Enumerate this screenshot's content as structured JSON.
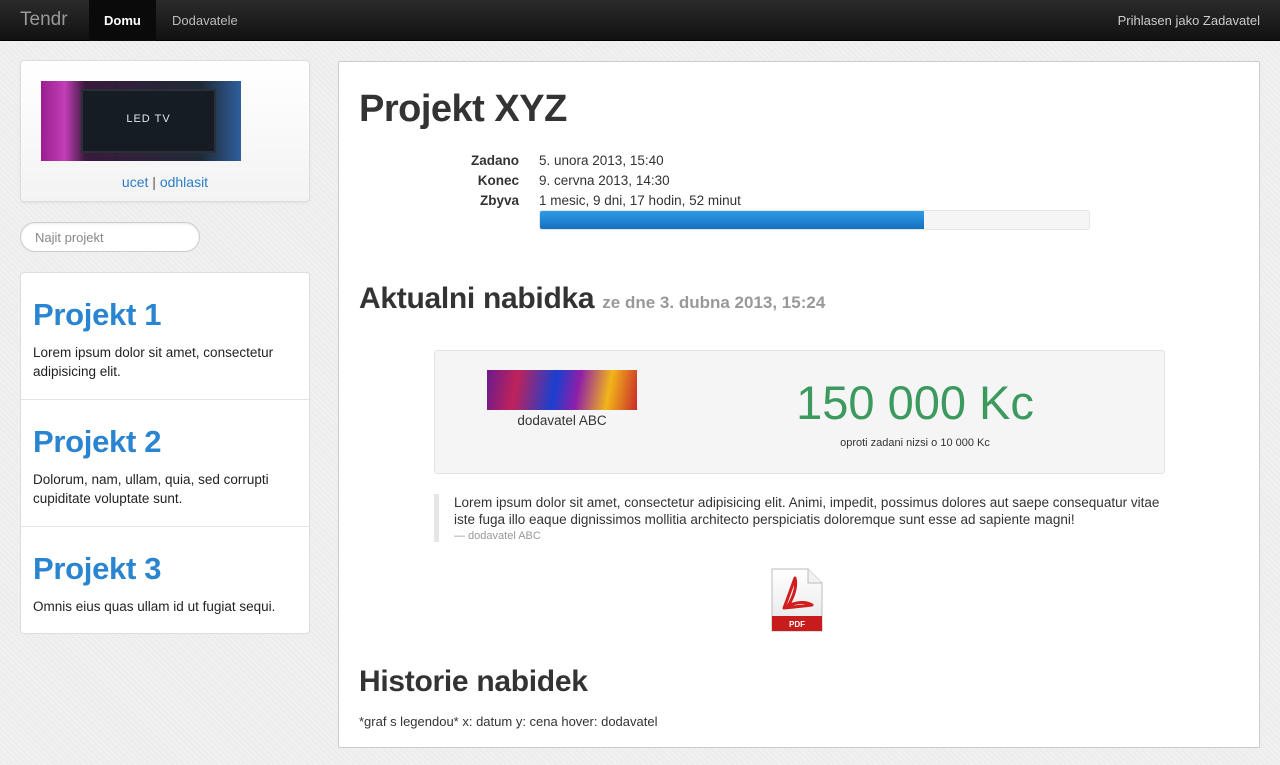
{
  "navbar": {
    "brand": "Tendr",
    "items": [
      {
        "label": "Domu",
        "active": true
      },
      {
        "label": "Dodavatele",
        "active": false
      }
    ],
    "user": "Prihlasen jako Zadavatel"
  },
  "account": {
    "thumb_text": "LED TV",
    "link_account": "ucet",
    "separator": "|",
    "link_logout": "odhlasit"
  },
  "search": {
    "placeholder": "Najit projekt"
  },
  "projects": [
    {
      "title": "Projekt 1",
      "text": "Lorem ipsum dolor sit amet, consectetur adipisicing elit."
    },
    {
      "title": "Projekt 2",
      "text": "Dolorum, nam, ullam, quia, sed corrupti cupiditate voluptate sunt."
    },
    {
      "title": "Projekt 3",
      "text": "Omnis eius quas ullam id ut fugiat sequi."
    }
  ],
  "main": {
    "title": "Projekt XYZ",
    "meta": {
      "assigned_label": "Zadano",
      "assigned_value": "5. unora 2013, 15:40",
      "end_label": "Konec",
      "end_value": "9. cervna 2013, 14:30",
      "remaining_label": "Zbyva",
      "remaining_value": "1 mesic, 9 dni, 17 hodin, 52 minut"
    },
    "progress_percent": 70
  },
  "offer": {
    "heading": "Aktualni nabidka",
    "heading_sub": "ze dne 3. dubna 2013, 15:24",
    "supplier": "dodavatel ABC",
    "price": "150 000 Kc",
    "price_note": "oproti zadani nizsi o 10 000 Kc",
    "quote_text": "Lorem ipsum dolor sit amet, consectetur adipisicing elit. Animi, impedit, possimus dolores aut saepe consequatur vitae iste fuga illo eaque dignissimos mollitia architecto perspiciatis doloremque sunt esse ad sapiente magni!",
    "quote_author": "— dodavatel ABC",
    "pdf_label": "PDF"
  },
  "history": {
    "heading": "Historie nabidek",
    "note": "*graf s legendou* x: datum y: cena hover: dodavatel"
  },
  "colors": {
    "accent": "#2a85d0",
    "price": "#3c9a5f",
    "progress": "#1a7fd4"
  }
}
